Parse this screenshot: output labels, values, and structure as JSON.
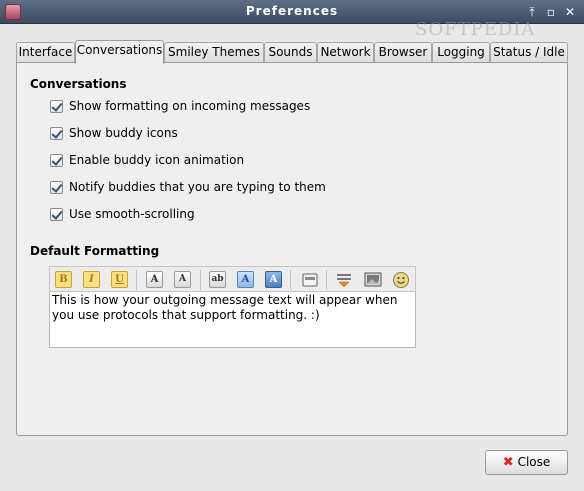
{
  "window": {
    "title": "Preferences",
    "watermark": "SOFTPEDIA"
  },
  "tabs": [
    {
      "label": "Interface"
    },
    {
      "label": "Conversations"
    },
    {
      "label": "Smiley Themes"
    },
    {
      "label": "Sounds"
    },
    {
      "label": "Network"
    },
    {
      "label": "Browser"
    },
    {
      "label": "Logging"
    },
    {
      "label": "Status / Idle"
    }
  ],
  "active_tab": "Conversations",
  "conversations": {
    "title": "Conversations",
    "options": [
      {
        "label": "Show formatting on incoming messages",
        "checked": true
      },
      {
        "label": "Show buddy icons",
        "checked": true
      },
      {
        "label": "Enable buddy icon animation",
        "checked": true
      },
      {
        "label": "Notify buddies that you are typing to them",
        "checked": true
      },
      {
        "label": "Use smooth-scrolling",
        "checked": true
      }
    ]
  },
  "default_formatting": {
    "title": "Default Formatting",
    "toolbar": {
      "bold": "B",
      "italic": "I",
      "underline": "U",
      "grow_font": "A",
      "shrink_font": "A",
      "font_face": "ab",
      "fg_color": "A",
      "bg_color": "A"
    },
    "preview_text": "This is how your outgoing message text will appear when you use protocols that support formatting. :)"
  },
  "buttons": {
    "close": "Close"
  }
}
